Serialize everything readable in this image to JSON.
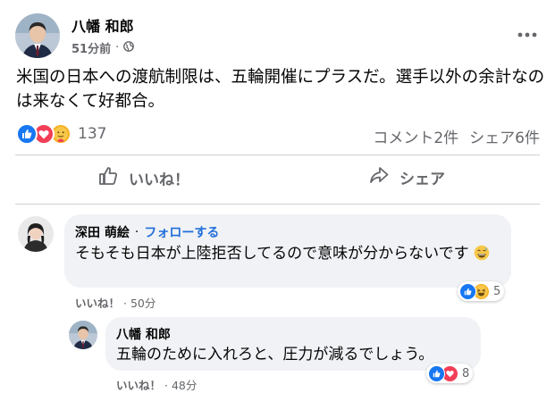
{
  "post": {
    "author": "八幡 和郎",
    "time": "51分前",
    "separator": "·",
    "text": "米国の日本への渡航制限は、五輪開催にプラスだ。選手以外の余計なのは来なくて好都合。",
    "reaction_count": "137",
    "comments_count": "コメント2件",
    "shares_count": "シェア6件"
  },
  "actions": {
    "like_label": "いいね！",
    "share_label": "シェア"
  },
  "comments": [
    {
      "author": "深田 萌絵",
      "separator": "·",
      "follow_label": "フォローする",
      "text": "そもそも日本が上陸拒否してるので意味が分からないです",
      "like_label": "いいね！",
      "time": "50分",
      "reaction_count": "5"
    },
    {
      "author": "八幡 和郎",
      "text": "五輪のために入れろと、圧力が減るでしょう。",
      "like_label": "いいね！",
      "time": "48分",
      "reaction_count": "8"
    }
  ],
  "icons": {
    "more": "more-dots-icon",
    "privacy": "globe-icon",
    "like": "thumbs-up-icon",
    "share": "share-arrow-icon"
  },
  "colors": {
    "like_blue": "#1877f2",
    "love_red": "#f33e58",
    "emoji_yellow": "#f7b125",
    "link_blue": "#216fdb",
    "muted_text": "#65676b",
    "bubble_bg": "#f0f2f5"
  }
}
